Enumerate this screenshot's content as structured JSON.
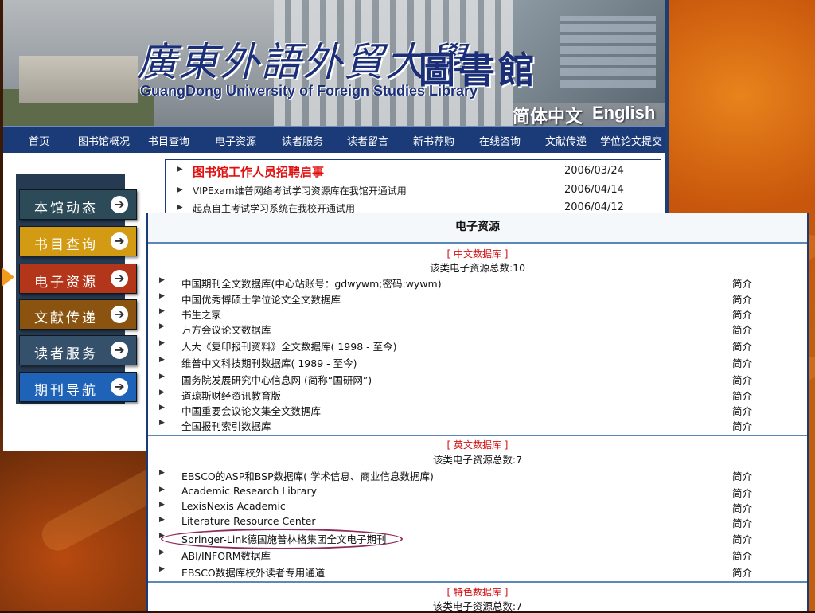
{
  "banner": {
    "title_cn": "廣東外語外貿大學",
    "title_lib": "圖書館",
    "title_en": "GuangDong University of Foreign Studies Library",
    "lang_simplified": "简体中文",
    "lang_english": "English"
  },
  "nav": {
    "items": [
      "首页",
      "图书馆概况",
      "书目查询",
      "电子资源",
      "读者服务",
      "读者留言",
      "新书荐购",
      "在线咨询",
      "文献传递",
      "学位论文提交"
    ]
  },
  "news": [
    {
      "text": "图书馆工作人员招聘启事",
      "date": "2006/03/24"
    },
    {
      "text": "VIPExam维普网络考试学习资源库在我馆开通试用",
      "date": "2006/04/14"
    },
    {
      "text": "起点自主考试学习系统在我校开通试用",
      "date": "2006/04/12"
    }
  ],
  "side_menu": {
    "items": [
      {
        "label": "本馆动态",
        "color": "#2d4a58"
      },
      {
        "label": "书目查询",
        "color": "#d39a14"
      },
      {
        "label": "电子资源",
        "color": "#b3361a"
      },
      {
        "label": "文献传递",
        "color": "#8a5410"
      },
      {
        "label": "读者服务",
        "color": "#34506a"
      },
      {
        "label": "期刊导航",
        "color": "#1f63b8"
      }
    ],
    "arrow_glyph": "➔"
  },
  "eres": {
    "title": "电子资源",
    "intro_label": "简介",
    "bullet": "▶",
    "categories": [
      {
        "head": "[ 中文数据库 ]",
        "count": "该类电子资源总数:10",
        "items": [
          "中国期刊全文数据库(中心站账号：gdwywm;密码:wywm)",
          "中国优秀博硕士学位论文全文数据库",
          "书生之家",
          "万方会议论文数据库",
          "人大《复印报刊资料》全文数据库( 1998 - 至今)",
          "维普中文科技期刊数据库( 1989 - 至今)",
          "国务院发展研究中心信息网 (简称“国研网”)",
          "道琼斯财经资讯教育版",
          "中国重要会议论文集全文数据库",
          "全国报刊索引数据库"
        ]
      },
      {
        "head": "[ 英文数据库 ]",
        "count": "该类电子资源总数:7",
        "items": [
          "EBSCO的ASP和BSP数据库( 学术信息、商业信息数据库)",
          "Academic Research Library",
          "LexisNexis Academic",
          "Literature Resource Center",
          "Springer-Link德国施普林格集团全文电子期刊",
          "ABI/INFORM数据库",
          "EBSCO数据库校外读者专用通道"
        ]
      },
      {
        "head": "[ 特色数据库 ]",
        "count": "该类电子资源总数:7",
        "items": []
      }
    ]
  }
}
